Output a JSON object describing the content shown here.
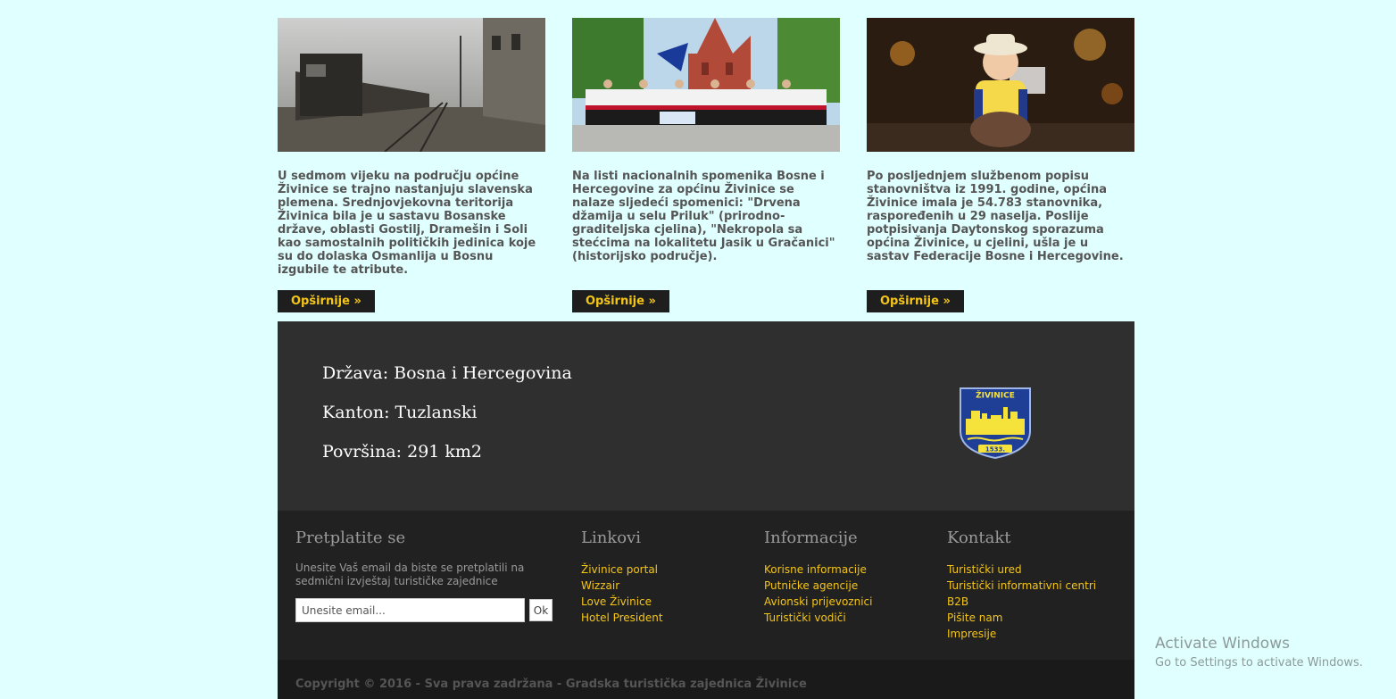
{
  "cards": [
    {
      "image_alt": "railway",
      "text": "U sedmom vijeku na području općine Živinice se trajno nastanjuju slavenska plemena. Srednjovjekovna teritorija Živinica bila je u sastavu Bosanske države, oblasti Gostilj, Dramešin i Soli kao samostalnih političkih jedinica koje su do dolaska Osmanlija u Bosnu izgubile te atribute.",
      "button": "Opširnije »"
    },
    {
      "image_alt": "folklore-group",
      "text": "Na listi nacionalnih spomenika Bosne i Hercegovine za općinu Živinice se nalaze sljedeći spomenici: \"Drvena džamija u selu Priluk\" (prirodno-graditeljska cjelina), \"Nekropola sa stećcima na lokalitetu Jasik u Gračanici\" (historijsko područje).",
      "button": "Opširnije »"
    },
    {
      "image_alt": "child",
      "text": "Po posljednjem službenom popisu stanovništva iz 1991. godine, općina Živinice imala je 54.783 stanovnika, raspoređenih u 29 naselja. Poslije potpisivanja Daytonskog sporazuma općina Živinice, u cjelini, ušla je u sastav Federacije Bosne i Hercegovine.",
      "button": "Opširnije »"
    }
  ],
  "info": {
    "drzava": "Država: Bosna i Hercegovina",
    "kanton": "Kanton: Tuzlanski",
    "povrsina": "Površina: 291 km2",
    "crest": {
      "top": "ŽIVINICE",
      "year": "1533."
    }
  },
  "footer": {
    "subscribe": {
      "title": "Pretplatite se",
      "text": "Unesite Vaš email da biste se pretplatili na sedmični izvještaj turističke zajednice",
      "placeholder": "Unesite email...",
      "button": "Ok"
    },
    "linkovi": {
      "title": "Linkovi",
      "items": [
        "Živinice portal",
        "Wizzair",
        "Love Živinice",
        "Hotel President"
      ]
    },
    "informacije": {
      "title": "Informacije",
      "items": [
        "Korisne informacije",
        "Putničke agencije",
        "Avionski prijevoznici",
        "Turistički vodiči"
      ]
    },
    "kontakt": {
      "title": "Kontakt",
      "items": [
        "Turistički ured",
        "Turistički informativni centri",
        "B2B",
        "Pišite nam",
        "Impresije"
      ]
    },
    "copyright": "Copyright © 2016 - Sva prava zadržana - Gradska turistička zajednica Živinice"
  },
  "watermark": {
    "title": "Activate Windows",
    "subtitle": "Go to Settings to activate Windows."
  },
  "colors": {
    "page_bg": "#e0ffff",
    "accent": "#f5c518",
    "dark_band": "#2f2f2f",
    "footer_bg": "#212121"
  }
}
